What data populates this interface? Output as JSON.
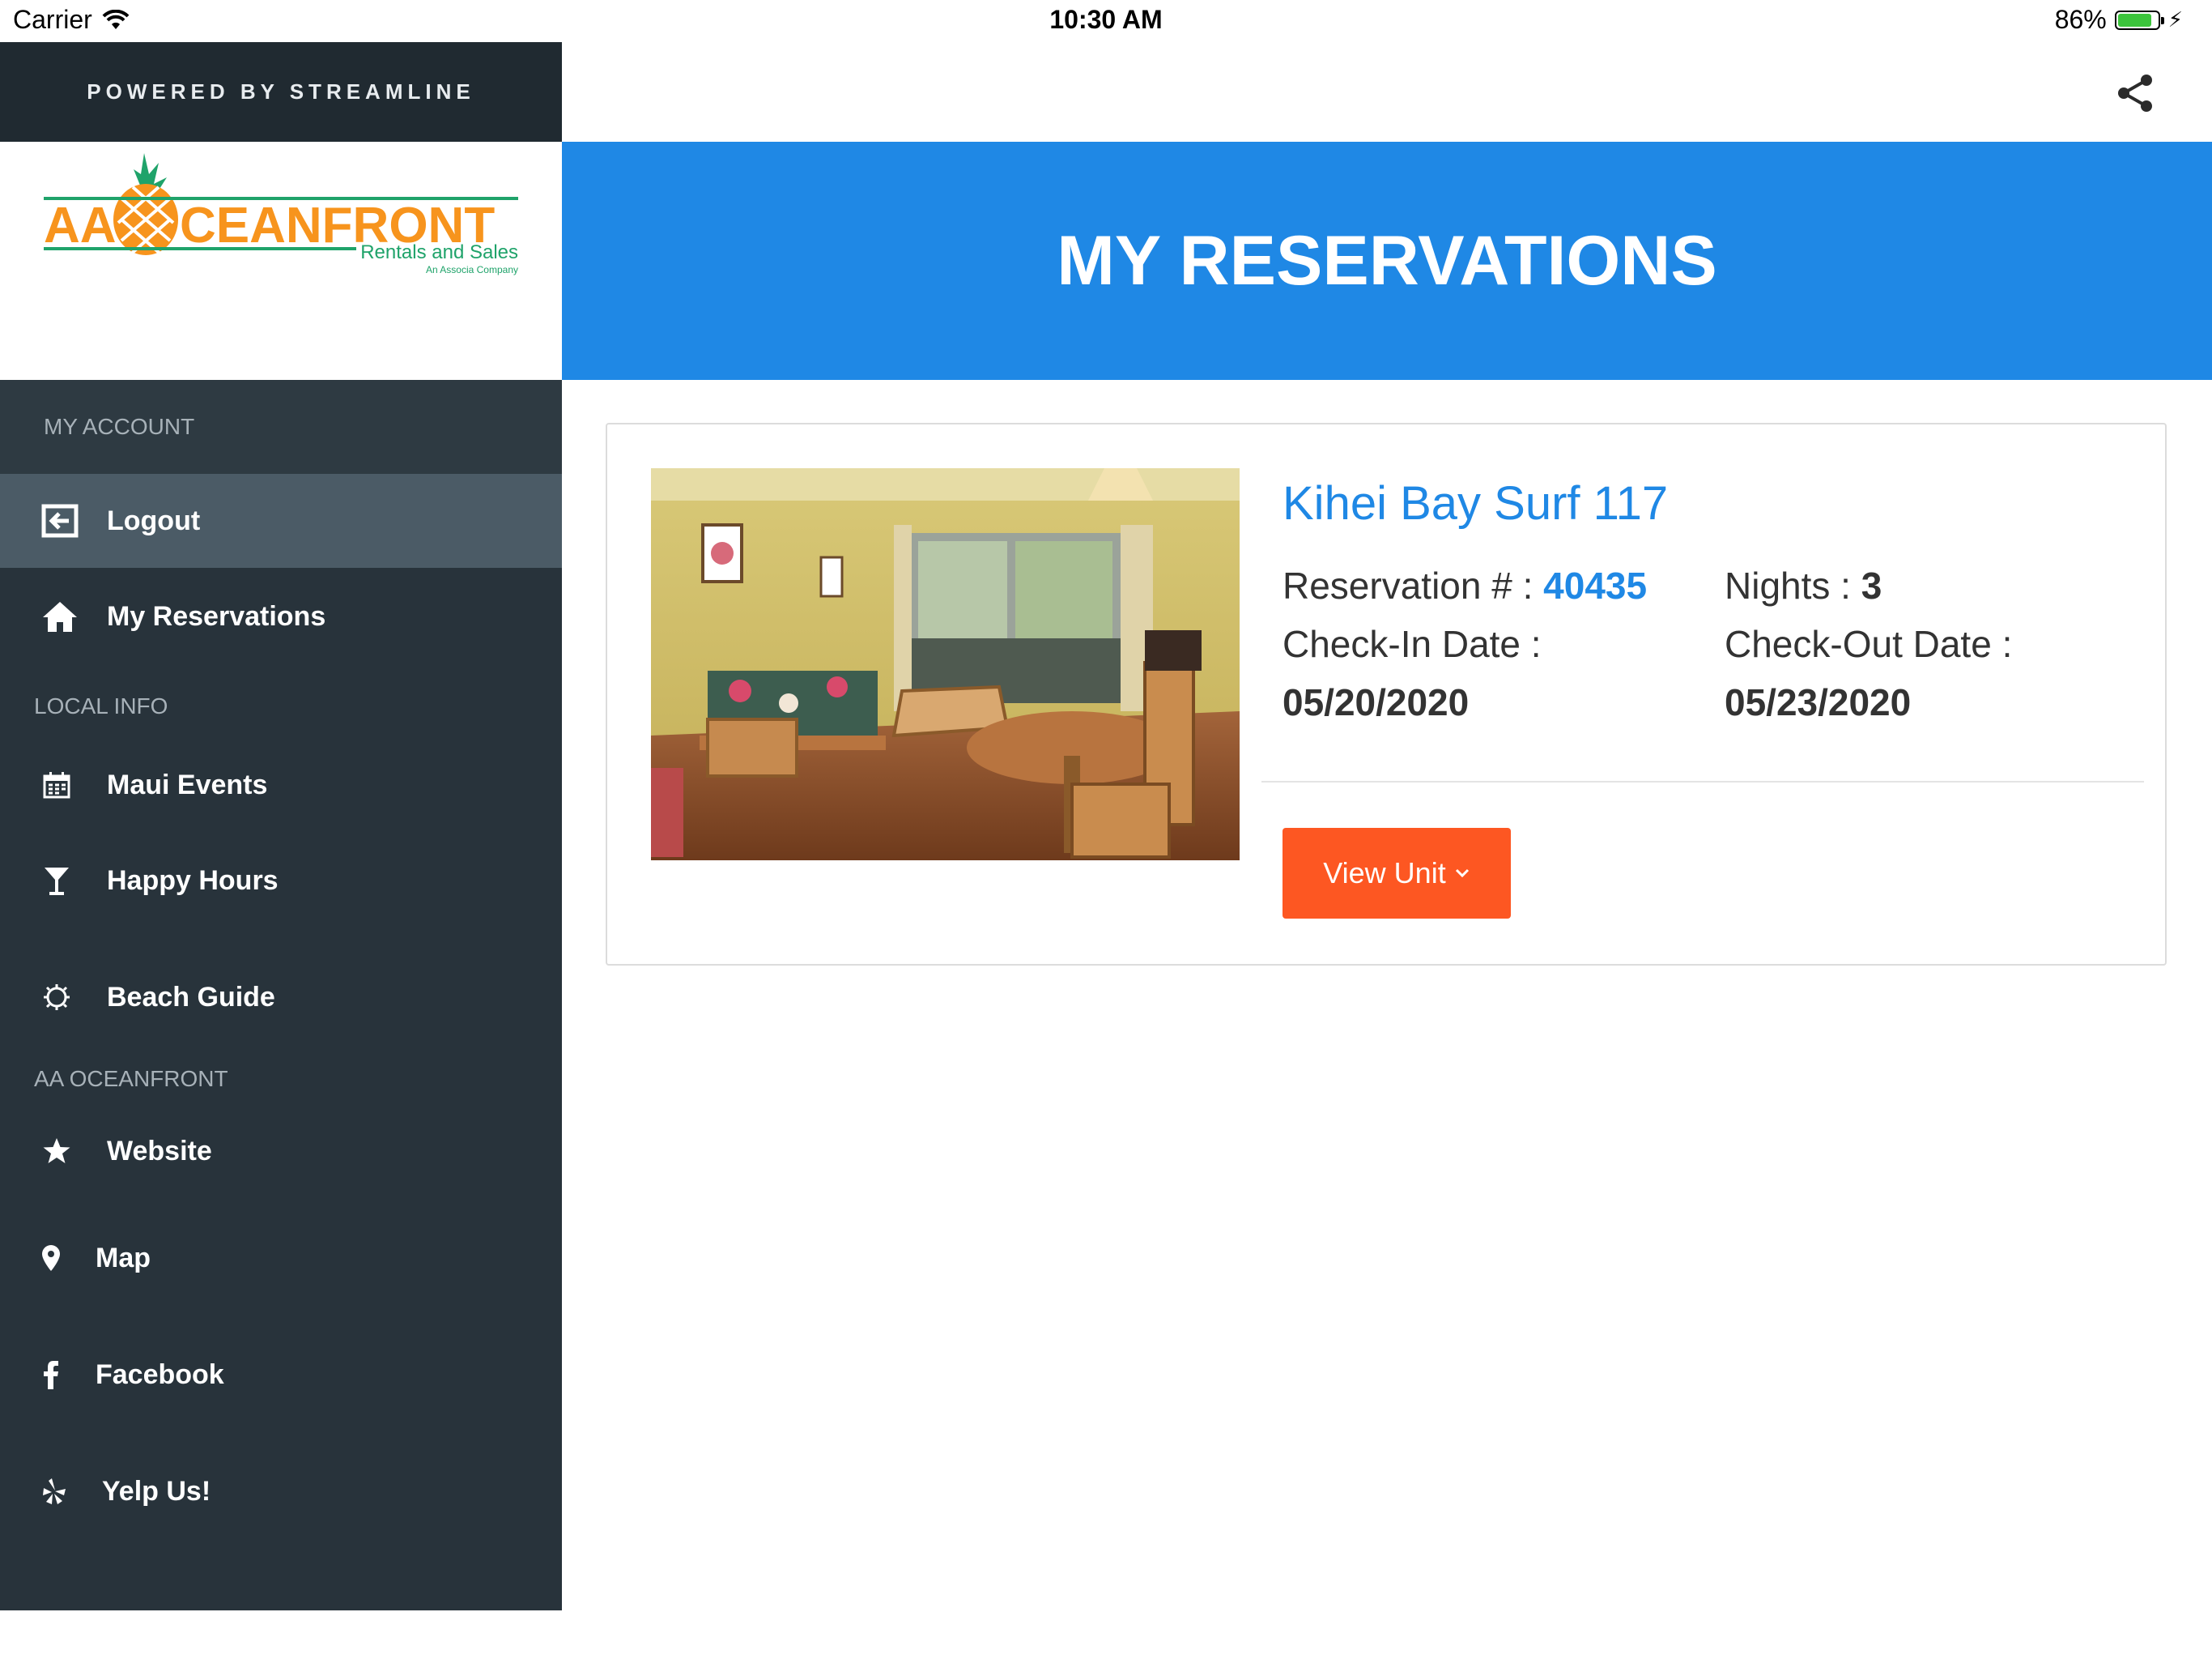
{
  "status_bar": {
    "carrier": "Carrier",
    "time": "10:30 AM",
    "battery": "86%",
    "battery_level": 0.86
  },
  "sidebar": {
    "powered_by": "POWERED BY STREAMLINE",
    "logo": {
      "brand": "AA OCEANFRONT",
      "tagline": "Rentals and Sales",
      "sub": "An Associa Company"
    },
    "sections": {
      "my_account": "MY ACCOUNT",
      "local_info": "LOCAL INFO",
      "aa_oceanfront": "AA OCEANFRONT"
    },
    "items": {
      "logout": "Logout",
      "my_reservations": "My Reservations",
      "maui_events": "Maui Events",
      "happy_hours": "Happy Hours",
      "beach_guide": "Beach Guide",
      "website": "Website",
      "map": "Map",
      "facebook": "Facebook",
      "yelp": "Yelp Us!"
    }
  },
  "header": {
    "title": "MY RESERVATIONS"
  },
  "reservation": {
    "unit_name": "Kihei Bay Surf 117",
    "reservation_label": "Reservation # : ",
    "reservation_number": "40435",
    "nights_label": "Nights : ",
    "nights": "3",
    "checkin_label": "Check-In Date :",
    "checkin_date": "05/20/2020",
    "checkout_label": "Check-Out Date :",
    "checkout_date": "05/23/2020",
    "view_button": "View Unit"
  },
  "colors": {
    "sidebar_bg": "#28333b",
    "accent_blue": "#1f88e5",
    "button_orange": "#fd5722",
    "brand_orange": "#f7941d",
    "brand_green": "#1fa36a"
  }
}
